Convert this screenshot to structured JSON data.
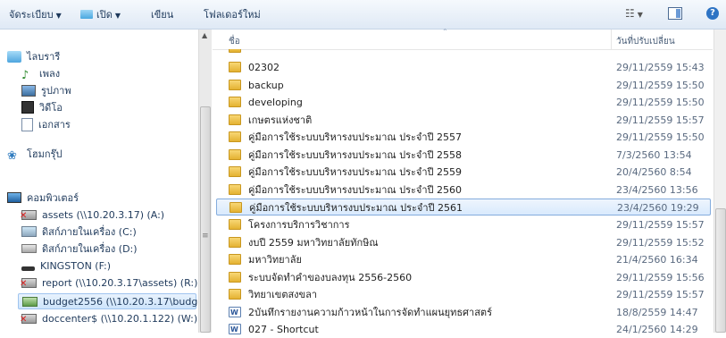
{
  "toolbar": {
    "organize_label": "จัดระเบียบ",
    "open_label": "เปิด",
    "burn_label": "เขียน",
    "new_folder_label": "โฟลเดอร์ใหม่"
  },
  "nav": {
    "items": [
      {
        "label": "ไลบรารี",
        "icon": "library-icon"
      },
      {
        "label": "เพลง",
        "icon": "music-icon"
      },
      {
        "label": "รูปภาพ",
        "icon": "pictures-icon"
      },
      {
        "label": "วิดีโอ",
        "icon": "videos-icon"
      },
      {
        "label": "เอกสาร",
        "icon": "documents-icon"
      },
      {
        "label": "โฮมกรุ๊ป",
        "icon": "homegroup-icon"
      },
      {
        "label": "คอมพิวเตอร์",
        "icon": "computer-icon"
      },
      {
        "label": "assets (\\\\10.20.3.17) (A:)",
        "icon": "network-drive-icon"
      },
      {
        "label": "ดิสก์ภายในเครื่อง (C:)",
        "icon": "windows-drive-icon"
      },
      {
        "label": "ดิสก์ภายในเครื่อง (D:)",
        "icon": "local-drive-icon"
      },
      {
        "label": "KINGSTON (F:)",
        "icon": "usb-drive-icon"
      },
      {
        "label": "report (\\\\10.20.3.17\\assets) (R:)",
        "icon": "network-drive-icon"
      },
      {
        "label": "budget2556 (\\\\10.20.3.17\\budget",
        "icon": "network-drive-icon"
      },
      {
        "label": "doccenter$ (\\\\10.20.1.122) (W:)",
        "icon": "network-drive-icon"
      }
    ]
  },
  "list": {
    "col_name": "ชื่อ",
    "col_date": "วันที่ปรับเปลี่ยน",
    "rows": [
      {
        "name": "02302",
        "date": "29/11/2559 15:43",
        "type": "folder"
      },
      {
        "name": "backup",
        "date": "29/11/2559 15:50",
        "type": "folder"
      },
      {
        "name": "developing",
        "date": "29/11/2559 15:50",
        "type": "folder"
      },
      {
        "name": "เกษตรแห่งชาติ",
        "date": "29/11/2559 15:57",
        "type": "folder"
      },
      {
        "name": "คู่มือการใช้ระบบบริหารงบประมาณ ประจำปี 2557",
        "date": "29/11/2559 15:50",
        "type": "folder"
      },
      {
        "name": "คู่มือการใช้ระบบบริหารงบประมาณ ประจำปี 2558",
        "date": "7/3/2560 13:54",
        "type": "folder"
      },
      {
        "name": "คู่มือการใช้ระบบบริหารงบประมาณ ประจำปี 2559",
        "date": "20/4/2560 8:54",
        "type": "folder"
      },
      {
        "name": "คู่มือการใช้ระบบบริหารงบประมาณ ประจำปี 2560",
        "date": "23/4/2560 13:56",
        "type": "folder"
      },
      {
        "name": "คู่มือการใช้ระบบบริหารงบประมาณ ประจำปี 2561",
        "date": "23/4/2560 19:29",
        "type": "folder",
        "selected": true
      },
      {
        "name": "โครงการบริการวิชาการ",
        "date": "29/11/2559 15:57",
        "type": "folder"
      },
      {
        "name": "งบปี 2559 มหาวิทยาลัยทักษิณ",
        "date": "29/11/2559 15:52",
        "type": "folder"
      },
      {
        "name": "มหาวิทยาลัย",
        "date": "21/4/2560 16:34",
        "type": "folder"
      },
      {
        "name": "ระบบจัดทำคำของบลงทุน 2556-2560",
        "date": "29/11/2559 15:56",
        "type": "folder"
      },
      {
        "name": "วิทยาเขตสงขลา",
        "date": "29/11/2559 15:57",
        "type": "folder"
      },
      {
        "name": "2บันทึกรายงานความก้าวหน้าในการจัดทำแผนยุทธศาสตร์",
        "date": "18/8/2559 14:47",
        "type": "doc"
      },
      {
        "name": "027 - Shortcut",
        "date": "24/1/2560 14:29",
        "type": "doc"
      }
    ]
  }
}
